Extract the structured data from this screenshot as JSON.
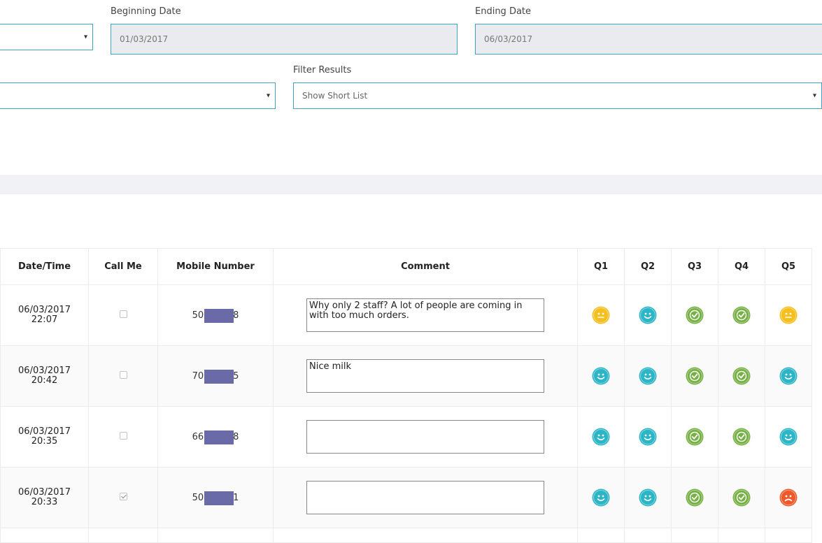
{
  "filters": {
    "beginning_date_label": "Beginning Date",
    "beginning_date_value": "01/03/2017",
    "ending_date_label": "Ending Date",
    "ending_date_value": "06/03/2017",
    "filter_results_label": "Filter Results",
    "filter_results_value": "Show Short List",
    "caret": "▾"
  },
  "table": {
    "headers": [
      "Date/Time",
      "Call Me",
      "Mobile Number",
      "Comment",
      "Q1",
      "Q2",
      "Q3",
      "Q4",
      "Q5"
    ],
    "rows": [
      {
        "date": "06/03/2017",
        "time": "22:07",
        "call_me": false,
        "mobile_prefix": "50",
        "mobile_suffix": "8",
        "comment": "Why only 2 staff? A lot of people are coming in with too much orders.",
        "q": [
          "neutral",
          "happy",
          "check",
          "check",
          "neutral"
        ]
      },
      {
        "date": "06/03/2017",
        "time": "20:42",
        "call_me": false,
        "mobile_prefix": "70",
        "mobile_suffix": "5",
        "comment": "Nice milk",
        "q": [
          "happy",
          "happy",
          "check",
          "check",
          "happy"
        ]
      },
      {
        "date": "06/03/2017",
        "time": "20:35",
        "call_me": false,
        "mobile_prefix": "66",
        "mobile_suffix": "8",
        "comment": "",
        "q": [
          "happy",
          "happy",
          "check",
          "check",
          "happy"
        ]
      },
      {
        "date": "06/03/2017",
        "time": "20:33",
        "call_me": true,
        "mobile_prefix": "50",
        "mobile_suffix": "1",
        "comment": "",
        "q": [
          "happy",
          "happy",
          "check",
          "check",
          "sad"
        ]
      }
    ]
  },
  "icon_colors": {
    "happy": "#2bb5c6",
    "neutral": "#f5bf1e",
    "check": "#75b043",
    "sad": "#ec5a2c"
  }
}
